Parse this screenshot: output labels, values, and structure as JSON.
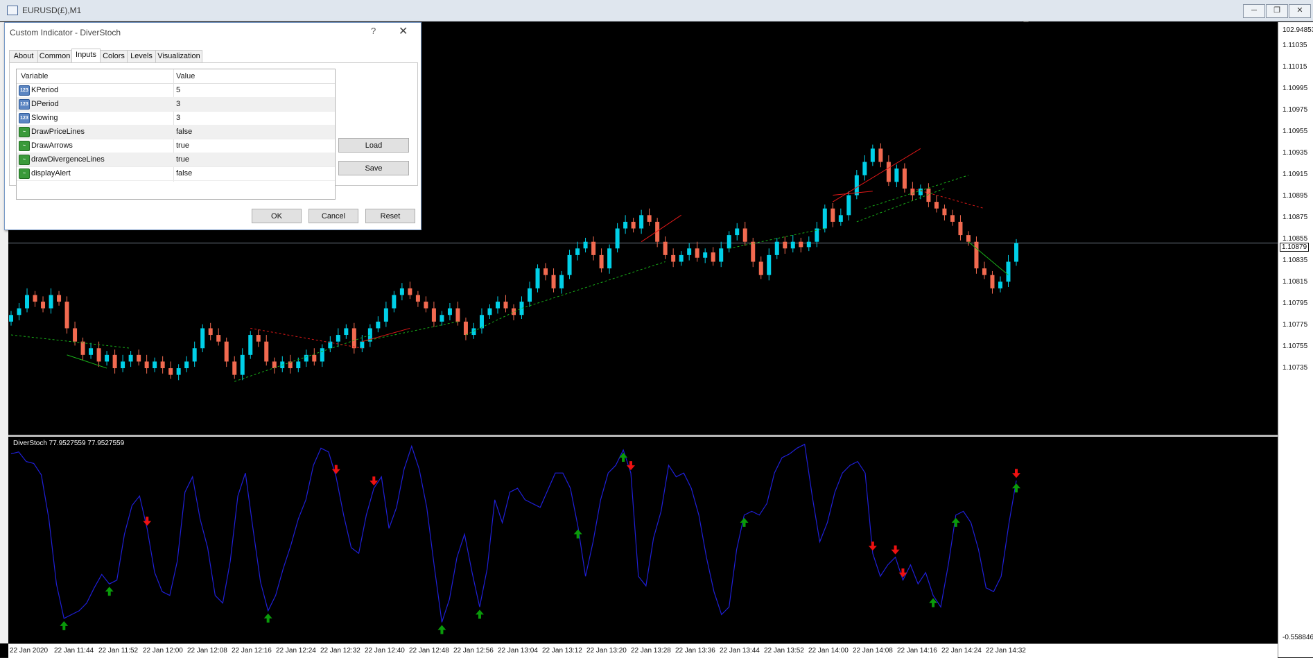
{
  "window": {
    "title": "EURUSD(£),M1"
  },
  "dialog": {
    "title": "Custom Indicator - DiverStoch",
    "help": "?",
    "tabs": [
      "About",
      "Common",
      "Inputs",
      "Colors",
      "Levels",
      "Visualization"
    ],
    "active_tab": "Inputs",
    "columns": {
      "variable": "Variable",
      "value": "Value"
    },
    "rows": [
      {
        "variable": "KPeriod",
        "value": "5",
        "type": "num"
      },
      {
        "variable": "DPeriod",
        "value": "3",
        "type": "num"
      },
      {
        "variable": "Slowing",
        "value": "3",
        "type": "num"
      },
      {
        "variable": "DrawPriceLines",
        "value": "false",
        "type": "bool"
      },
      {
        "variable": "DrawArrows",
        "value": "true",
        "type": "bool"
      },
      {
        "variable": "drawDivergenceLines",
        "value": "true",
        "type": "bool"
      },
      {
        "variable": "displayAlert",
        "value": "false",
        "type": "bool"
      }
    ],
    "buttons": {
      "load": "Load",
      "save": "Save",
      "ok": "OK",
      "cancel": "Cancel",
      "reset": "Reset"
    }
  },
  "price_axis": {
    "labels": [
      "1.11035",
      "1.11015",
      "1.10995",
      "1.10975",
      "1.10955",
      "1.10935",
      "1.10915",
      "1.10895",
      "1.10875",
      "1.10855",
      "1.10835",
      "1.10815",
      "1.10795",
      "1.10775",
      "1.10755",
      "1.10735"
    ],
    "current": "1.10879"
  },
  "sub_window": {
    "title": "DiverStoch 77.9527559 77.9527559",
    "axis_top": "102.94853",
    "axis_bottom": "-0.558846"
  },
  "time_axis": {
    "labels": [
      "22 Jan 2020",
      "22 Jan 11:44",
      "22 Jan 11:52",
      "22 Jan 12:00",
      "22 Jan 12:08",
      "22 Jan 12:16",
      "22 Jan 12:24",
      "22 Jan 12:32",
      "22 Jan 12:40",
      "22 Jan 12:48",
      "22 Jan 12:56",
      "22 Jan 13:04",
      "22 Jan 13:12",
      "22 Jan 13:20",
      "22 Jan 13:28",
      "22 Jan 13:36",
      "22 Jan 13:44",
      "22 Jan 13:52",
      "22 Jan 14:00",
      "22 Jan 14:08",
      "22 Jan 14:16",
      "22 Jan 14:24",
      "22 Jan 14:32"
    ]
  },
  "colors": {
    "bull": "#00d0e8",
    "bear": "#f26a50",
    "stoch": "#1f1fd8",
    "up_arrow": "#0a9a0a",
    "down_arrow": "#ee1111",
    "bull_div": "#18b018",
    "bear_div": "#e01818"
  },
  "chart_data": {
    "type": "candlestick",
    "price_range": [
      1.10735,
      1.11045
    ],
    "closes": [
      1.10825,
      1.1083,
      1.1084,
      1.10835,
      1.1083,
      1.1084,
      1.10835,
      1.10815,
      1.10805,
      1.10795,
      1.108,
      1.1079,
      1.10795,
      1.10785,
      1.1079,
      1.10795,
      1.1079,
      1.10785,
      1.1079,
      1.10785,
      1.1078,
      1.10785,
      1.1079,
      1.108,
      1.10815,
      1.1081,
      1.10805,
      1.1079,
      1.1078,
      1.10795,
      1.1081,
      1.10805,
      1.1079,
      1.10785,
      1.1079,
      1.10785,
      1.1079,
      1.10795,
      1.1079,
      1.108,
      1.10805,
      1.1081,
      1.10815,
      1.108,
      1.10805,
      1.10815,
      1.1082,
      1.1083,
      1.1084,
      1.10845,
      1.1084,
      1.10835,
      1.1083,
      1.1082,
      1.10825,
      1.1083,
      1.1082,
      1.1081,
      1.10815,
      1.10825,
      1.1083,
      1.10835,
      1.1083,
      1.10825,
      1.10835,
      1.10845,
      1.1086,
      1.10855,
      1.10845,
      1.10855,
      1.1087,
      1.10875,
      1.1088,
      1.1087,
      1.1086,
      1.10875,
      1.1089,
      1.10895,
      1.1089,
      1.109,
      1.10895,
      1.1088,
      1.1087,
      1.10865,
      1.1087,
      1.10875,
      1.10868,
      1.10872,
      1.10865,
      1.10875,
      1.10885,
      1.1089,
      1.1088,
      1.10865,
      1.10855,
      1.1087,
      1.1088,
      1.10875,
      1.1088,
      1.10876,
      1.1088,
      1.1089,
      1.10905,
      1.10895,
      1.109,
      1.10915,
      1.1093,
      1.1094,
      1.1095,
      1.1094,
      1.10925,
      1.10935,
      1.1092,
      1.10915,
      1.1092,
      1.1091,
      1.10905,
      1.109,
      1.10895,
      1.10885,
      1.1088,
      1.1086,
      1.10855,
      1.10845,
      1.1085,
      1.10865,
      1.10879
    ],
    "stochastic": [
      94,
      95,
      90,
      89,
      83,
      60,
      26,
      8,
      10,
      12,
      16,
      24,
      31,
      26,
      28,
      52,
      67,
      72,
      55,
      32,
      22,
      20,
      38,
      74,
      82,
      60,
      45,
      20,
      16,
      38,
      72,
      84,
      55,
      27,
      12,
      20,
      34,
      46,
      60,
      70,
      88,
      97,
      95,
      82,
      62,
      45,
      42,
      62,
      76,
      82,
      55,
      66,
      86,
      98,
      86,
      66,
      35,
      6,
      18,
      40,
      52,
      32,
      14,
      34,
      70,
      58,
      74,
      76,
      70,
      68,
      66,
      75,
      84,
      84,
      76,
      56,
      30,
      48,
      70,
      84,
      88,
      96,
      84,
      30,
      25,
      50,
      64,
      88,
      82,
      84,
      76,
      62,
      40,
      22,
      10,
      14,
      44,
      62,
      64,
      62,
      68,
      84,
      92,
      94,
      97,
      99,
      72,
      48,
      58,
      74,
      84,
      88,
      90,
      84,
      42,
      30,
      36,
      40,
      28,
      36,
      26,
      32,
      20,
      14,
      36,
      62,
      64,
      58,
      44,
      24,
      22,
      30,
      57,
      80
    ]
  }
}
